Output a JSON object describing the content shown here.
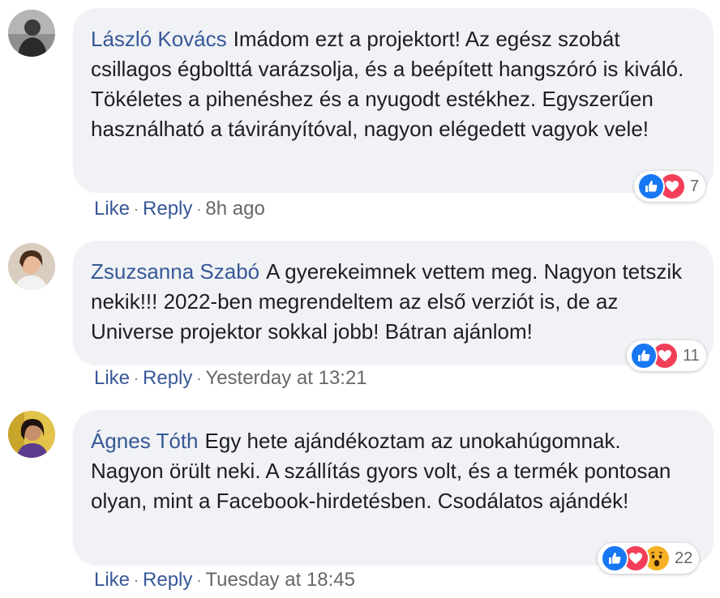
{
  "comments": [
    {
      "author": "László Kovács",
      "text": "Imádom ezt a projektort! Az egész szobát csillagos égbolttá varázsolja, és a beépített hangszóró is kiváló. Tökéletes a pihenéshez és a nyugodt estékhez. Egyszerűen használható a távirányítóval, nagyon elégedett vagyok vele!",
      "reactions": [
        "like",
        "love"
      ],
      "reaction_count": "7",
      "like_label": "Like",
      "reply_label": "Reply",
      "separator": "·",
      "time": "8h ago"
    },
    {
      "author": "Zsuzsanna Szabó",
      "text": "A gyerekeimnek vettem meg. Nagyon tetszik nekik!!! 2022-ben megrendeltem az első verziót is, de az Universe projektor sokkal jobb! Bátran ajánlom!",
      "reactions": [
        "like",
        "love"
      ],
      "reaction_count": "11",
      "like_label": "Like",
      "reply_label": "Reply",
      "separator": "·",
      "time": "Yesterday at 13:21"
    },
    {
      "author": "Ágnes Tóth",
      "text": "Egy hete ajándékoztam az unokahúgomnak. Nagyon örült neki. A szállítás gyors volt, és a termék pontosan olyan, mint a Facebook-hirdetésben. Csodálatos ajándék!",
      "reactions": [
        "like",
        "love",
        "wow"
      ],
      "reaction_count": "22",
      "like_label": "Like",
      "reply_label": "Reply",
      "separator": "·",
      "time": "Tuesday at 18:45"
    }
  ],
  "colors": {
    "author_link": "#385898",
    "bubble_bg": "#f0f2f5",
    "meta_text": "#65676b",
    "like_blue": "#1877f2",
    "love_red": "#f33e58",
    "wow_yellow": "#f7b125"
  },
  "icons": [
    "avatar",
    "like-icon",
    "love-icon",
    "wow-icon"
  ]
}
